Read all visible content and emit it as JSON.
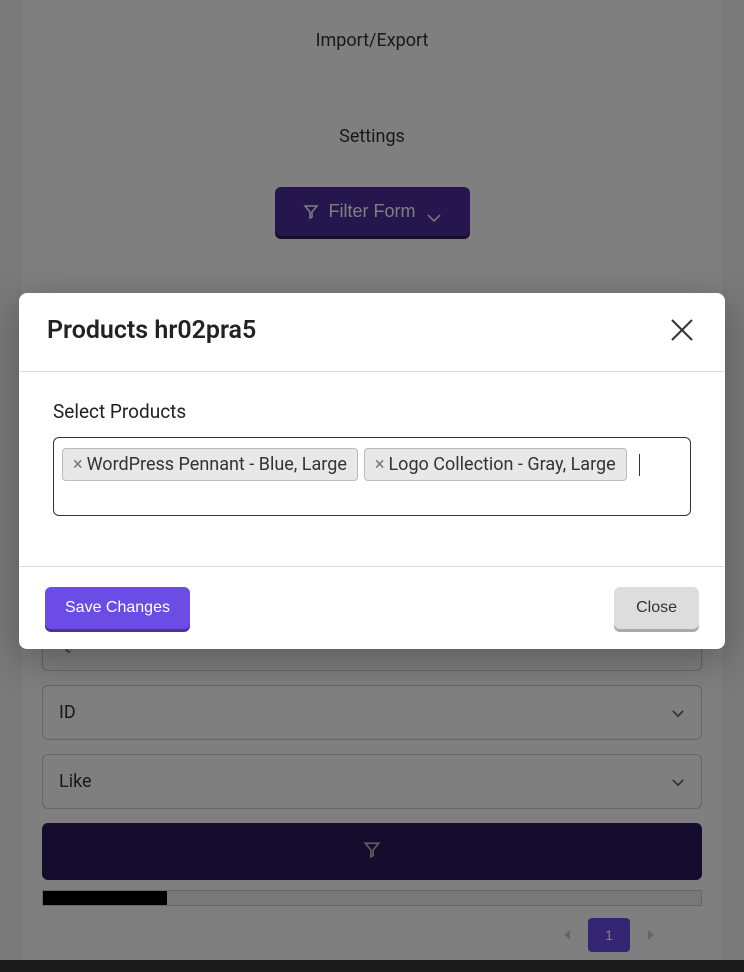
{
  "nav": {
    "import_export": "Import/Export",
    "settings": "Settings",
    "filter_form": "Filter Form"
  },
  "search": {
    "placeholder": "Quick Search ...",
    "field1": "ID",
    "field2": "Like"
  },
  "pagination": {
    "current": "1"
  },
  "modal": {
    "title": "Products hr02pra5",
    "select_label": "Select Products",
    "tags": [
      "WordPress Pennant - Blue, Large",
      "Logo Collection - Gray, Large"
    ],
    "save_label": "Save Changes",
    "close_label": "Close"
  }
}
